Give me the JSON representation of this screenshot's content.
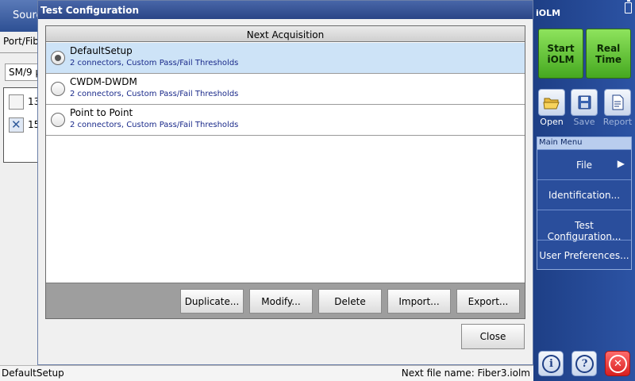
{
  "background": {
    "tab_label": "Sourc",
    "port_label": "Port/Fib",
    "fiber_select": "SM/9 µ",
    "checks": [
      {
        "label": "13",
        "checked": false
      },
      {
        "label": "15",
        "checked": true
      }
    ]
  },
  "dialog": {
    "title": "Test Configuration",
    "list_header": "Next Acquisition",
    "items": [
      {
        "name": "DefaultSetup",
        "details": "2 connectors, Custom Pass/Fail Thresholds",
        "selected": true
      },
      {
        "name": "CWDM-DWDM",
        "details": "2 connectors, Custom Pass/Fail Thresholds",
        "selected": false
      },
      {
        "name": "Point to Point",
        "details": "2 connectors, Custom Pass/Fail Thresholds",
        "selected": false
      }
    ],
    "buttons": {
      "duplicate": "Duplicate...",
      "modify": "Modify...",
      "delete": "Delete",
      "import": "Import...",
      "export": "Export...",
      "close": "Close"
    }
  },
  "status_bar": {
    "left": "DefaultSetup",
    "right": "Next file name: Fiber3.iolm"
  },
  "sidebar": {
    "title": "iOLM",
    "start_button": "Start\niOLM",
    "realtime_button": "Real\nTime",
    "tools": [
      {
        "label": "Open",
        "icon": "folder-open-icon",
        "enabled": true
      },
      {
        "label": "Save",
        "icon": "floppy-icon",
        "enabled": false
      },
      {
        "label": "Report",
        "icon": "report-icon",
        "enabled": false
      }
    ],
    "main_menu": {
      "header": "Main Menu",
      "items": [
        "File",
        "Identification...",
        "Test Configuration...",
        "User Preferences..."
      ]
    },
    "bottom_icons": [
      "info-icon",
      "help-icon",
      "close-icon"
    ]
  },
  "colors": {
    "accent_blue": "#2a4e9c",
    "selected_row": "#cde3f7",
    "start_green": "#45a820",
    "exit_red": "#d81f1f",
    "detail_text": "#1a2a8a"
  }
}
